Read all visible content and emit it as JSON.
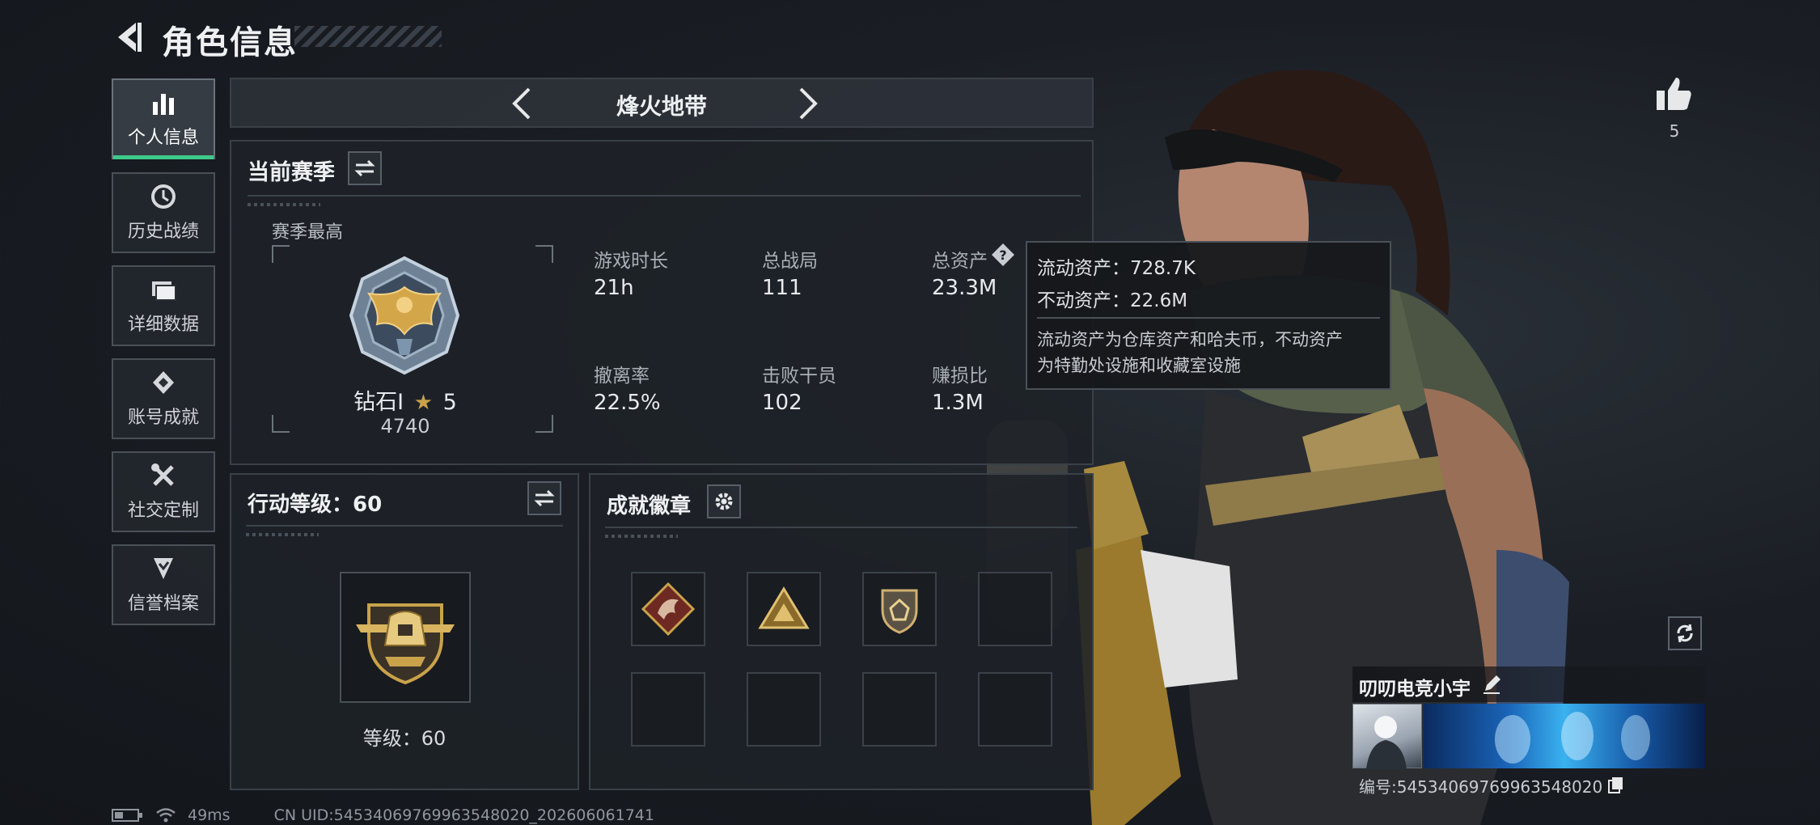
{
  "header": {
    "title": "角色信息"
  },
  "sidebar": {
    "items": [
      {
        "label": "个人信息",
        "icon": "bar-chart-icon",
        "active": true
      },
      {
        "label": "历史战绩",
        "icon": "history-icon",
        "active": false
      },
      {
        "label": "详细数据",
        "icon": "folder-icon",
        "active": false
      },
      {
        "label": "账号成就",
        "icon": "achievement-icon",
        "active": false
      },
      {
        "label": "社交定制",
        "icon": "tools-icon",
        "active": false
      },
      {
        "label": "信誉档案",
        "icon": "shield-check-icon",
        "active": false
      }
    ]
  },
  "mode_selector": {
    "current": "烽火地带"
  },
  "season": {
    "title": "当前赛季",
    "best_label": "赛季最高",
    "rank_name": "钻石Ⅰ",
    "rank_stars": "5",
    "rank_points": "4740",
    "stats": [
      {
        "label": "游戏时长",
        "value": "21h"
      },
      {
        "label": "总战局",
        "value": "111"
      },
      {
        "label": "总资产",
        "value": "23.3M"
      },
      {
        "label": "撤离率",
        "value": "22.5%"
      },
      {
        "label": "击败干员",
        "value": "102"
      },
      {
        "label": "赚损比",
        "value": "1.3M"
      }
    ]
  },
  "tooltip": {
    "liquid": "流动资产：728.7K",
    "fixed": "不动资产：22.6M",
    "desc_line1": "流动资产为仓库资产和哈夫币，不动资产",
    "desc_line2": "为特勤处设施和收藏室设施"
  },
  "action_level": {
    "title": "行动等级：60",
    "level_text": "等级：60"
  },
  "badges": {
    "title": "成就徽章"
  },
  "likes": {
    "count": "5"
  },
  "player": {
    "name": "叨叨电竞小宇",
    "id_text": "编号:54534069769963548020"
  },
  "status_bar": {
    "ping": "49ms",
    "uid": "CN UID:54534069769963548020_202606061741"
  },
  "colors": {
    "accent": "#3fc98a",
    "gold": "#c9a24a"
  }
}
